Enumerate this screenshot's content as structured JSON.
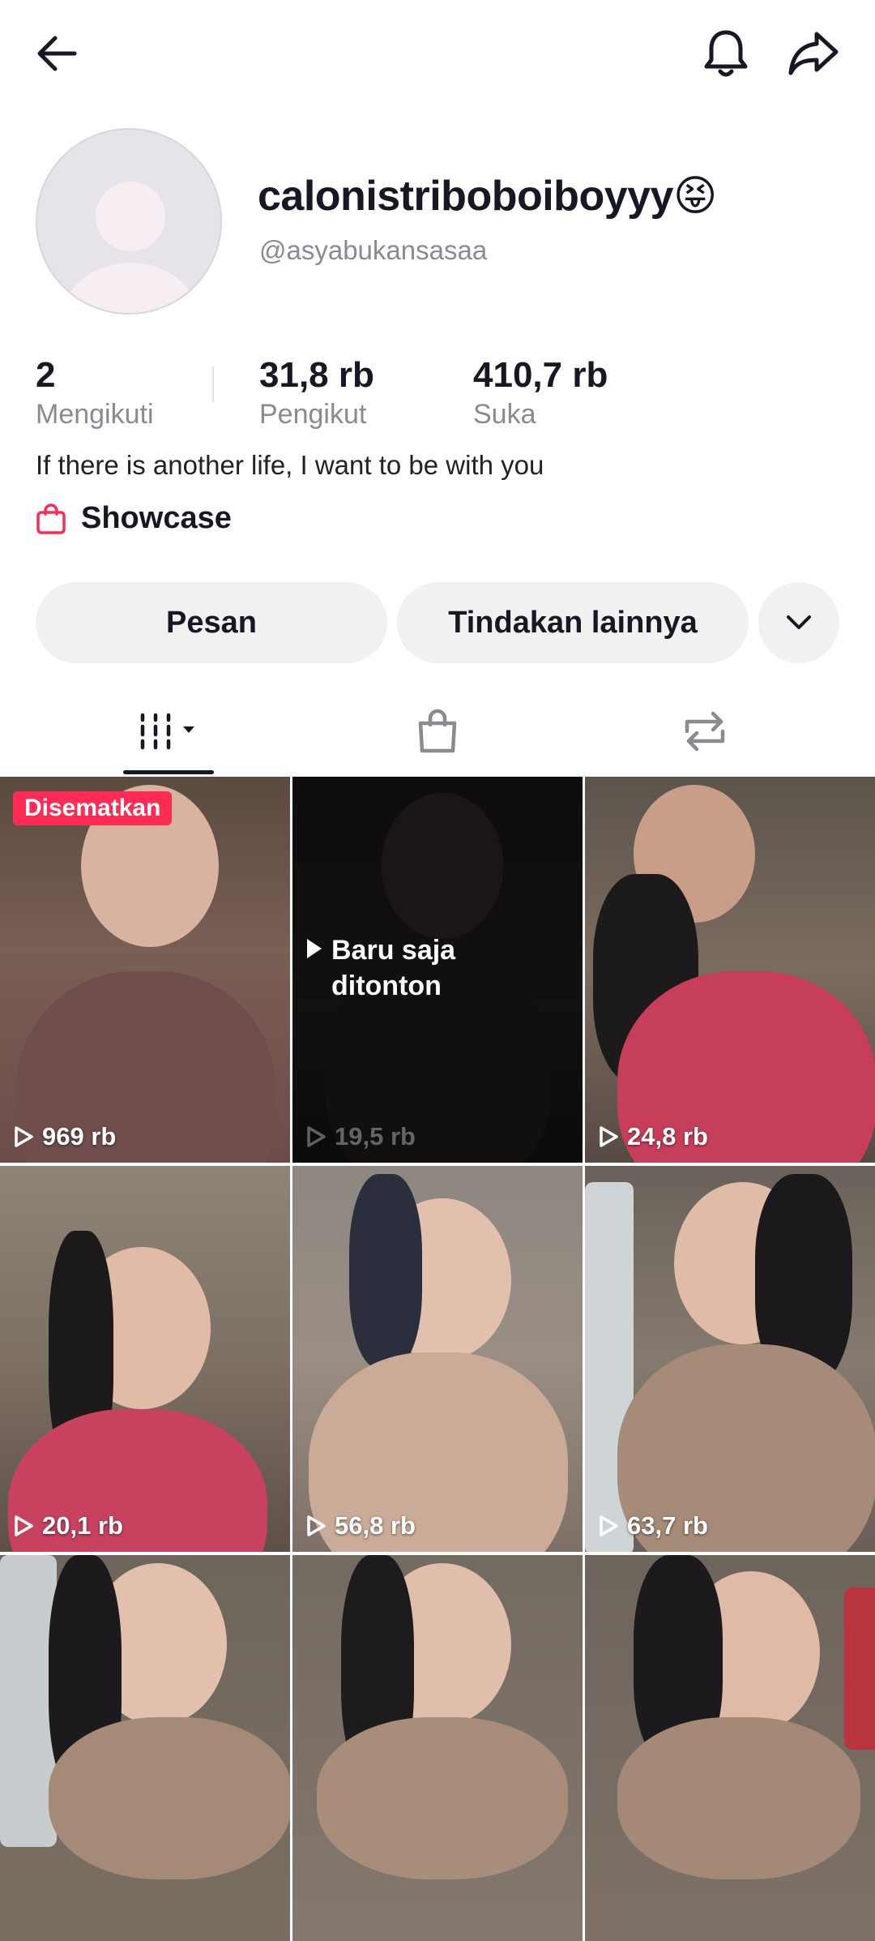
{
  "header": {
    "back_icon": "arrow-left-icon",
    "bell_icon": "bell-icon",
    "share_icon": "share-arrow-icon"
  },
  "profile": {
    "display_name": "calonistriboboiboyyy😝",
    "username": "@asyabukansasaa",
    "bio": "If there is another life, I want to be with you",
    "showcase_label": "Showcase"
  },
  "stats": [
    {
      "value": "2",
      "label": "Mengikuti"
    },
    {
      "value": "31,8 rb",
      "label": "Pengikut"
    },
    {
      "value": "410,7 rb",
      "label": "Suka"
    }
  ],
  "actions": {
    "message_label": "Pesan",
    "more_label": "Tindakan lainnya",
    "dropdown_icon": "chevron-down-icon"
  },
  "tabs": [
    {
      "name": "videos",
      "icon": "grid-menu-icon",
      "active": true
    },
    {
      "name": "shop",
      "icon": "shopping-bag-icon"
    },
    {
      "name": "reposts",
      "icon": "repost-icon"
    }
  ],
  "videos": [
    {
      "views": "969 rb",
      "pinned_label": "Disematkan"
    },
    {
      "views": "19,5 rb",
      "watched_label": "Baru saja ditonton"
    },
    {
      "views": "24,8 rb"
    },
    {
      "views": "20,1 rb"
    },
    {
      "views": "56,8 rb"
    },
    {
      "views": "63,7 rb"
    },
    {
      "views": ""
    },
    {
      "views": ""
    },
    {
      "views": ""
    }
  ],
  "colors": {
    "accent": "#fe2c55",
    "text": "#161823",
    "muted": "#8a8b91",
    "pill_bg": "#f1f1f2"
  }
}
